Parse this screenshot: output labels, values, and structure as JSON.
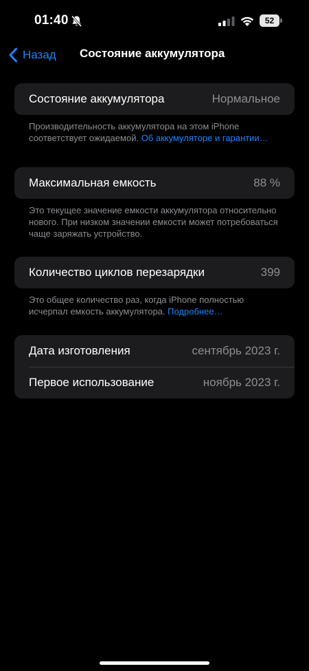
{
  "status_bar": {
    "time": "01:40",
    "battery_level": "52",
    "icons": [
      "bell-off-icon",
      "signal-icon",
      "wifi-icon",
      "battery-icon"
    ]
  },
  "nav": {
    "back_label": "Назад",
    "title": "Состояние аккумулятора",
    "accent_color": "#1e84ff"
  },
  "battery_health": {
    "label": "Состояние аккумулятора",
    "value": "Нормальное",
    "footer_text": "Производительность аккумулятора на этом iPhone соответствует ожидаемой. ",
    "footer_link": "Об аккумуляторе и гарантии…"
  },
  "max_capacity": {
    "label": "Максимальная емкость",
    "value": "88 %",
    "footer_text": "Это текущее значение емкости аккумулятора относительно нового. При низком значении емкости может потребоваться чаще заряжать устройство."
  },
  "cycle_count": {
    "label": "Количество циклов перезарядки",
    "value": "399",
    "footer_text": "Это общее количество раз, когда iPhone полностью исчерпал емкость аккумулятора. ",
    "footer_link": "Подробнее…"
  },
  "dates": {
    "manufacture_label": "Дата изготовления",
    "manufacture_value": "сентябрь 2023 г.",
    "first_use_label": "Первое использование",
    "first_use_value": "ноябрь 2023 г."
  }
}
